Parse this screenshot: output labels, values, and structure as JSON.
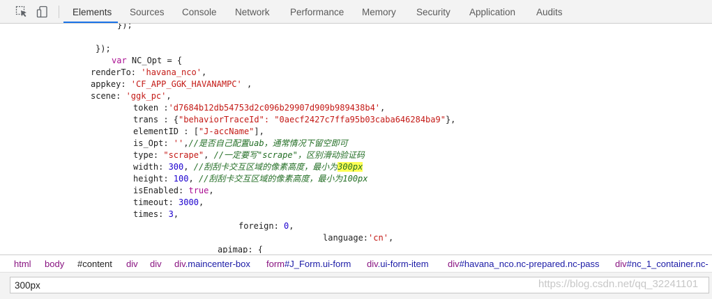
{
  "toolbar": {
    "inspect_icon": "inspect-element-icon",
    "device_icon": "device-toolbar-icon"
  },
  "tabs": [
    "Elements",
    "Sources",
    "Console",
    "Network",
    "Performance",
    "Memory",
    "Security",
    "Application",
    "Audits"
  ],
  "active_tab": "Elements",
  "code": {
    "l1": "});",
    "l2": "});",
    "l3_kw": "var",
    "l3_rest": " NC_Opt = {",
    "l4_key": "renderTo: ",
    "l4_val": "'havana_nco'",
    "l4_end": ",",
    "l5_key": "appkey: ",
    "l5_val": "'CF_APP_GGK_HAVANAMPC'",
    "l5_end": " ,",
    "l6_key": "scene: ",
    "l6_val": "'ggk_pc'",
    "l6_end": ",",
    "l7_key": "token :",
    "l7_val": "'d7684b12db54753d2c096b29907d909b989438b4'",
    "l7_end": ",",
    "l8_key": "trans : {",
    "l8_val": "\"behaviorTraceId\": \"0aecf2427c7ffa95b03caba646284ba9\"",
    "l8_end": "},",
    "l9_key": "elementID : [",
    "l9_val": "\"J-accName\"",
    "l9_end": "],",
    "l10_key": "is_Opt: ",
    "l10_val": "''",
    "l10_end": ",",
    "l10_cmt": "//是否自己配置uab，通常情况下留空即可",
    "l11_key": "type: ",
    "l11_val": "\"scrape\"",
    "l11_end": ", ",
    "l11_cmt": "//一定要写\"scrape\"，区别滑动验证码",
    "l12_key": "width: ",
    "l12_val": "300",
    "l12_end": ", ",
    "l12_cmt": "//刮刮卡交互区域的像素高度，最小为",
    "l12_hl": "300px",
    "l13_key": "height: ",
    "l13_val": "100",
    "l13_end": ", ",
    "l13_cmt": "//刮刮卡交互区域的像素高度，最小为100px",
    "l14_key": "isEnabled: ",
    "l14_val": "true",
    "l14_end": ",",
    "l15_key": "timeout: ",
    "l15_val": "3000",
    "l15_end": ",",
    "l16_key": "times: ",
    "l16_val": "3",
    "l16_end": ",",
    "l17_key": "foreign: ",
    "l17_val": "0",
    "l17_end": ",",
    "l18_key": "language:",
    "l18_val": "'cn'",
    "l18_end": ",",
    "l19": "apimap: {"
  },
  "breadcrumb": [
    {
      "tag": "html",
      "cls": ""
    },
    {
      "tag": "body",
      "cls": ""
    },
    {
      "tag": "#content",
      "cls": ""
    },
    {
      "tag": "div",
      "cls": ""
    },
    {
      "tag": "div",
      "cls": ""
    },
    {
      "tag": "div",
      "cls": ".maincenter-box"
    },
    {
      "tag": "form",
      "cls": "#J_Form.ui-form"
    },
    {
      "tag": "div",
      "cls": ".ui-form-item"
    },
    {
      "tag": "div",
      "cls": "#havana_nco.nc-prepared.nc-pass"
    },
    {
      "tag": "div",
      "cls": "#nc_1_container.nc-"
    }
  ],
  "search": {
    "value": "300px"
  },
  "watermark": "https://blog.csdn.net/qq_32241101"
}
